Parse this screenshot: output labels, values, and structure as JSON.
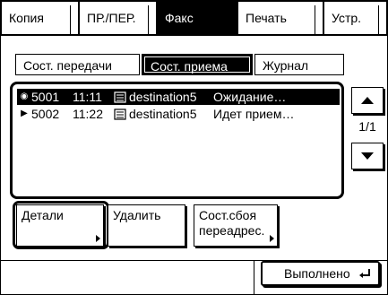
{
  "mode_tabs": [
    {
      "label": "Копия",
      "active": false
    },
    {
      "label": "ПР./ПЕР.",
      "active": false
    },
    {
      "label": "Факс",
      "active": true
    },
    {
      "label": "Печать",
      "active": false
    },
    {
      "label": "Устр.",
      "active": false
    }
  ],
  "sub_tabs": [
    {
      "label": "Сост. передачи",
      "active": false
    },
    {
      "label": "Сост. приема",
      "active": true
    },
    {
      "label": "Журнал",
      "active": false
    }
  ],
  "jobs": [
    {
      "number": "5001",
      "time": "11:11",
      "destination": "destination5",
      "status": "Ожидание…",
      "selected": true,
      "marker_icon": "radio-selected-icon"
    },
    {
      "number": "5002",
      "time": "11:22",
      "destination": "destination5",
      "status": "Идет прием…",
      "selected": false,
      "marker_icon": "play-arrow-icon"
    }
  ],
  "pagination": {
    "page": "1/1"
  },
  "actions": {
    "details_label": "Детали",
    "delete_label": "Удалить",
    "forward_error_line1": "Сост.сбоя",
    "forward_error_line2": "переадрес."
  },
  "done_label": "Выполнено",
  "colors": {
    "foreground": "#000000",
    "background": "#ffffff"
  }
}
